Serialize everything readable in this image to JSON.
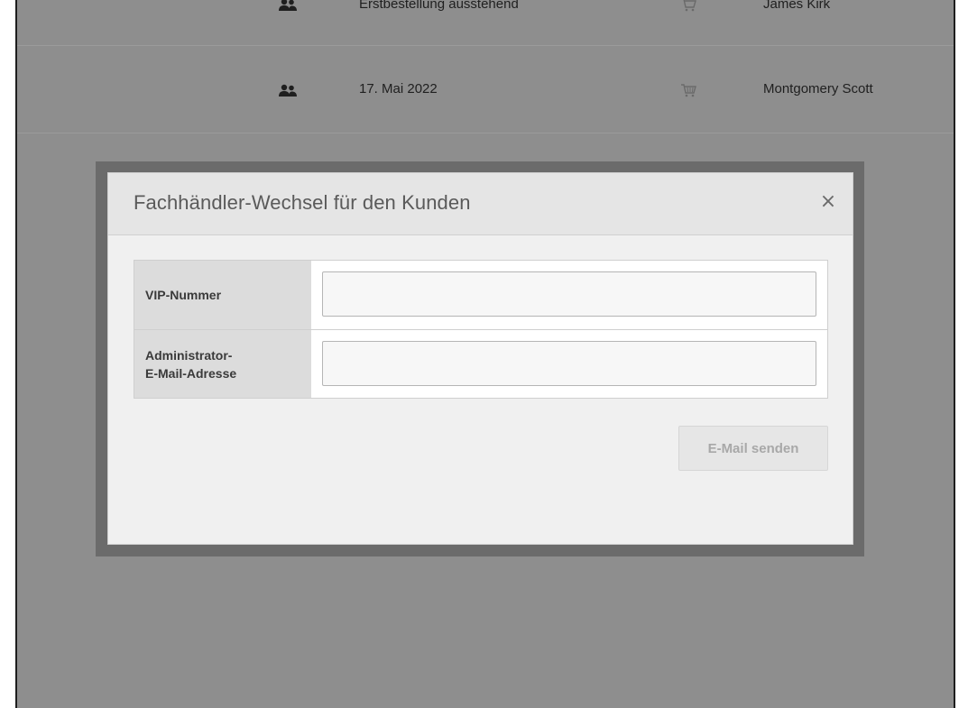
{
  "rows": [
    {
      "date": "Erstbestellung ausstehend",
      "name": "James Kirk"
    },
    {
      "date": "17. Mai 2022",
      "name": "Montgomery Scott"
    }
  ],
  "icons": {
    "people": "people-icon",
    "cart": "cart-icon",
    "close": "close-icon"
  },
  "modal": {
    "title": "Fachhändler-Wechsel für den Kunden",
    "close_glyph": "×",
    "fields": [
      {
        "label": "VIP-Nummer",
        "value": "",
        "placeholder": ""
      },
      {
        "label_line1": "Administrator-",
        "label_line2": "E-Mail-Adresse",
        "value": "",
        "placeholder": ""
      }
    ],
    "send_label": "E-Mail senden"
  },
  "colors": {
    "overlay": "#8e8e8e",
    "modal_bg": "#f0f0f0",
    "header_bg": "#e5e5e5",
    "label_bg": "#dcdcdc"
  }
}
